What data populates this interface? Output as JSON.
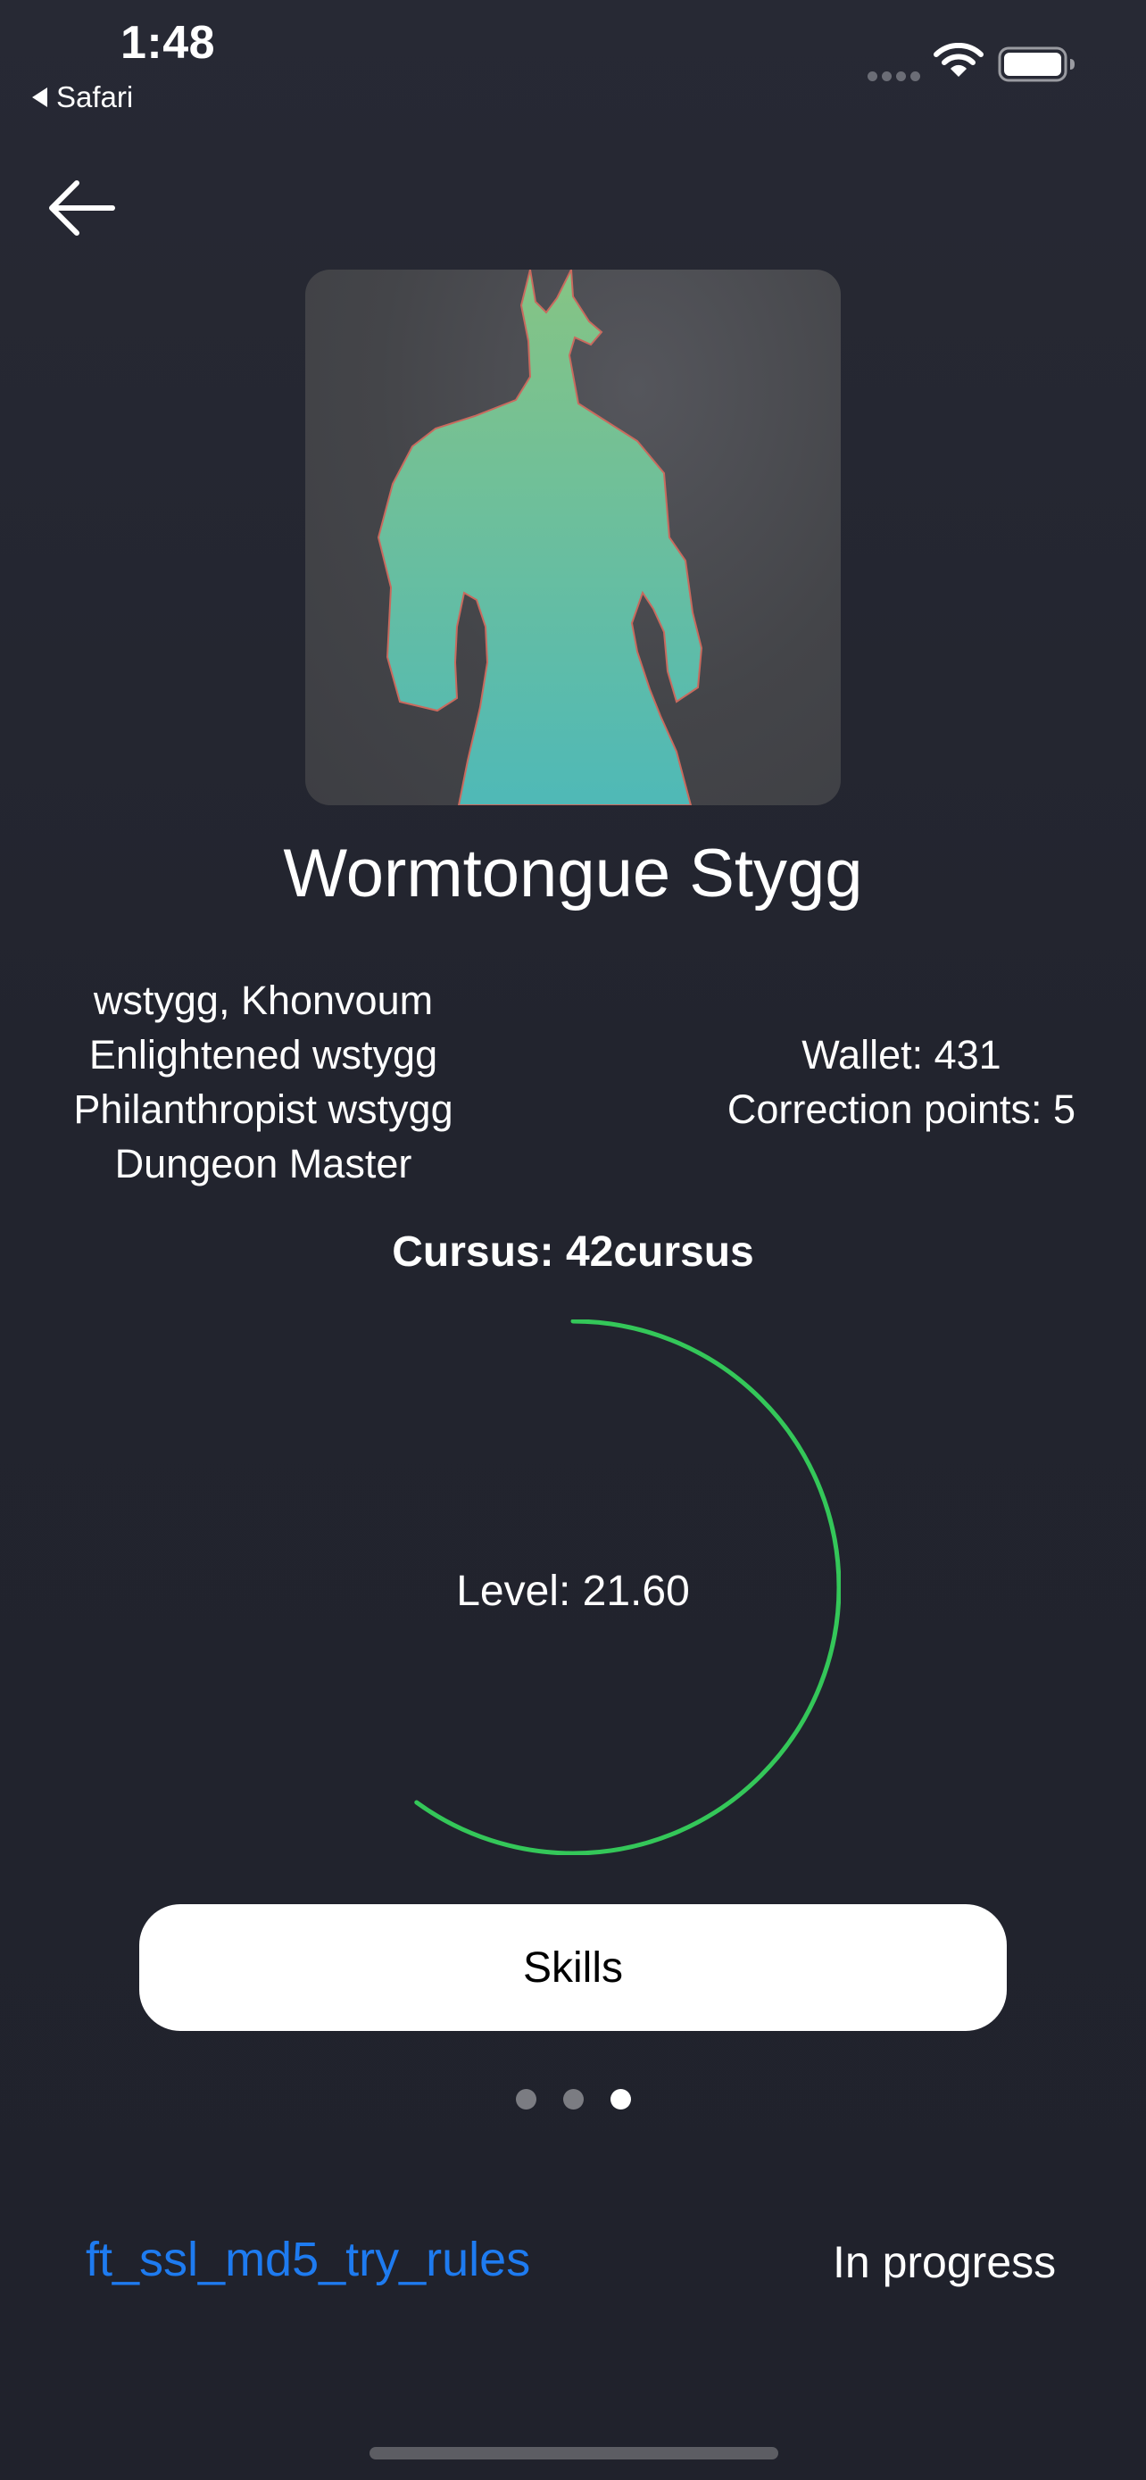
{
  "status_bar": {
    "time": "1:48",
    "back_app": "Safari"
  },
  "profile": {
    "display_name": "Wormtongue Stygg",
    "titles": [
      "wstygg, Khonvoum",
      "Enlightened wstygg",
      "Philanthropist wstygg",
      "Dungeon Master"
    ],
    "wallet": "Wallet: 431",
    "correction_points": "Correction points: 5"
  },
  "cursus": {
    "label": "Cursus: 42cursus",
    "level": "Level: 21.60",
    "progress": 0.6
  },
  "skills_button": {
    "label": "Skills"
  },
  "pager": {
    "count": 3,
    "active_index": 2
  },
  "project": {
    "name": "ft_ssl_md5_try_rules",
    "status": "In progress"
  },
  "colors": {
    "background": "#22242e",
    "progress_ring": "#34c759",
    "link": "#1e7bf0"
  },
  "icons": {
    "back": "arrow-left-icon",
    "status_back": "chevron-left-icon",
    "wifi": "wifi-icon",
    "battery": "battery-icon",
    "cellular": "cellular-signal-icon"
  }
}
